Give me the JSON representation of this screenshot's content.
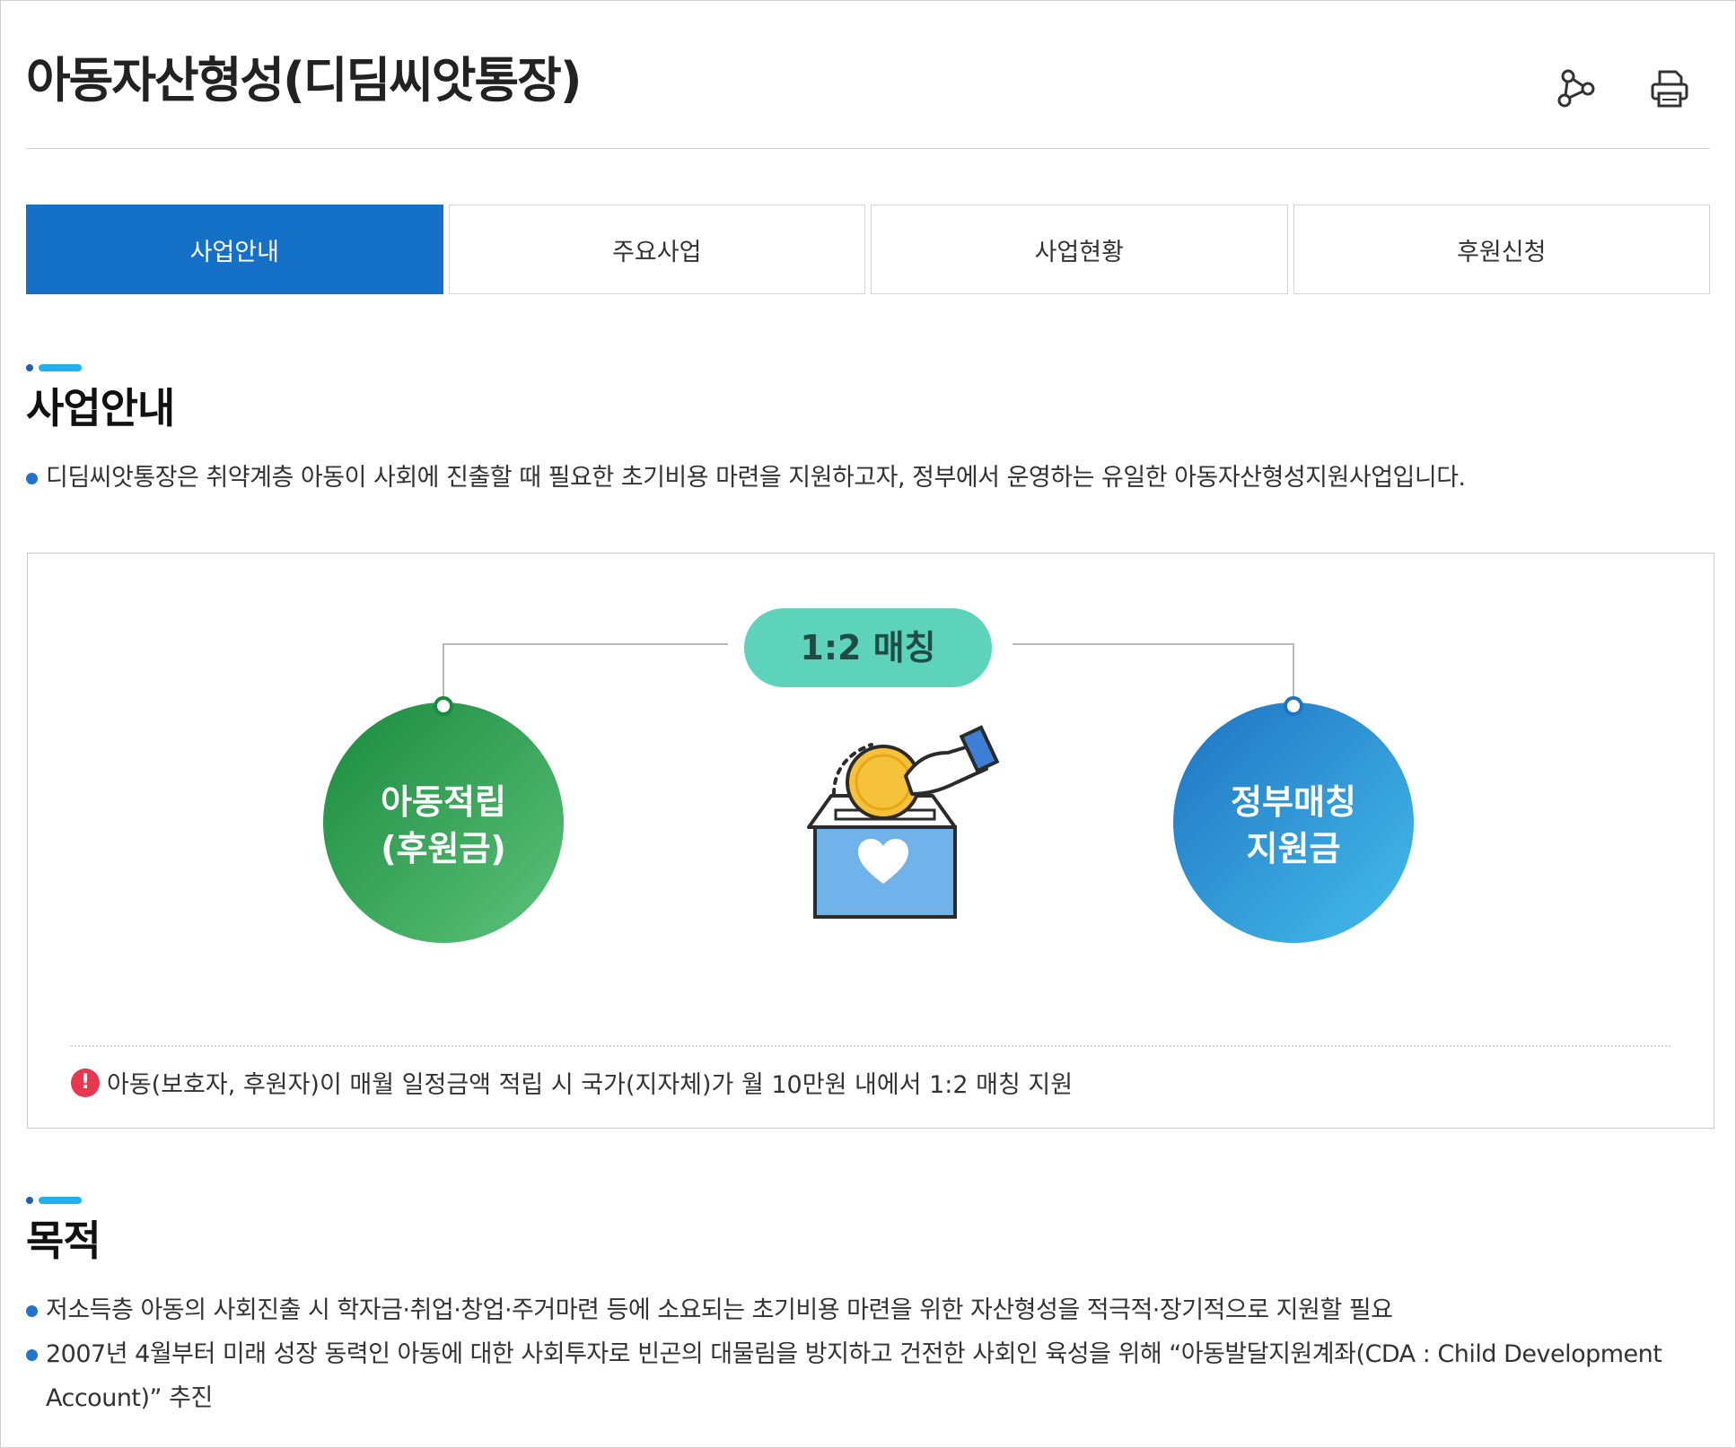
{
  "page": {
    "title": "아동자산형성(디딤씨앗통장)"
  },
  "header_icons": [
    "share-icon",
    "print-icon"
  ],
  "tabs": [
    {
      "label": "사업안내",
      "active": true
    },
    {
      "label": "주요사업",
      "active": false
    },
    {
      "label": "사업현황",
      "active": false
    },
    {
      "label": "후원신청",
      "active": false
    }
  ],
  "section_intro": {
    "title": "사업안내",
    "text": "디딤씨앗통장은 취약계층 아동이 사회에 진출할 때 필요한 초기비용 마련을 지원하고자, 정부에서 운영하는 유일한 아동자산형성지원사업입니다."
  },
  "diagram": {
    "badge": "1:2 매칭",
    "left_circle_line1": "아동적립",
    "left_circle_line2": "(후원금)",
    "right_circle_line1": "정부매칭",
    "right_circle_line2": "지원금",
    "note": "아동(보호자, 후원자)이 매월 일정금액 적립 시 국가(지자체)가 월 10만원 내에서 1:2 매칭 지원",
    "note_icon": "!"
  },
  "section_purpose": {
    "title": "목적",
    "items": [
      "저소득층 아동의 사회진출 시 학자금·취업·창업·주거마련 등에 소요되는 초기비용 마련을 위한 자산형성을 적극적·장기적으로 지원할 필요",
      "2007년 4월부터 미래 성장 동력인 아동에 대한 사회투자로 빈곤의 대물림을 방지하고 건전한 사회인 육성을 위해 “아동발달지원계좌(CDA : Child Development Account)” 추진"
    ]
  },
  "colors": {
    "tab_active": "#1571c8",
    "badge": "#5dd3bb",
    "green_circle": "#2a9d4e",
    "blue_circle": "#2b8fd6",
    "bullet": "#1f75c9",
    "accent_bar": "#1fb2ee",
    "warn": "#e8384f"
  }
}
